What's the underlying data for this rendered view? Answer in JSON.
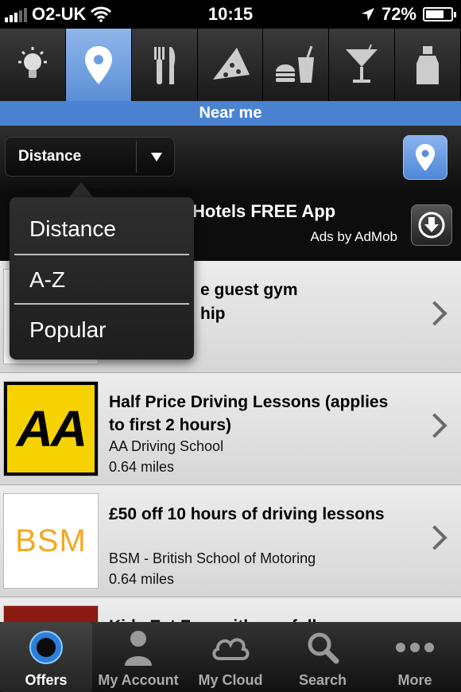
{
  "status_bar": {
    "carrier": "O2-UK",
    "time": "10:15",
    "battery": "72%",
    "battery_level": 0.72
  },
  "categories": [
    {
      "icon": "lightbulb-icon",
      "active": false
    },
    {
      "icon": "location-pin-icon",
      "active": true
    },
    {
      "icon": "fork-knife-icon",
      "active": false
    },
    {
      "icon": "pizza-icon",
      "active": false
    },
    {
      "icon": "fastfood-icon",
      "active": false
    },
    {
      "icon": "cocktail-icon",
      "active": false
    },
    {
      "icon": "bottle-icon",
      "active": false
    }
  ],
  "section_title": "Near me",
  "sort": {
    "selected": "Distance",
    "options": [
      "Distance",
      "A-Z",
      "Popular"
    ]
  },
  "ad": {
    "title": "Hotels FREE App",
    "byline": "Ads by AdMob"
  },
  "offers": [
    {
      "title_visible": [
        "e guest gym",
        "hip"
      ],
      "subtitle": "",
      "distance": ""
    },
    {
      "title": "Half Price Driving Lessons (applies to first 2 hours)",
      "merchant": "AA Driving School",
      "distance": "0.64 miles",
      "logo_text": "AA"
    },
    {
      "title": "£50 off 10 hours of driving lessons",
      "merchant": "BSM - British School of Motoring",
      "distance": "0.64 miles",
      "logo_text": "BSM"
    },
    {
      "title_partial": "Kids Eat Free with any full",
      "merchant": "",
      "distance": ""
    }
  ],
  "tabs": [
    {
      "label": "Offers",
      "icon": "offers-icon",
      "active": true
    },
    {
      "label": "My Account",
      "icon": "person-icon",
      "active": false
    },
    {
      "label": "My Cloud",
      "icon": "cloud-icon",
      "active": false
    },
    {
      "label": "Search",
      "icon": "search-icon",
      "active": false
    },
    {
      "label": "More",
      "icon": "more-dots-icon",
      "active": false
    }
  ],
  "colors": {
    "accent": "#4b82d2",
    "aa_yellow": "#f6d200",
    "bsm_orange": "#f5a623"
  }
}
